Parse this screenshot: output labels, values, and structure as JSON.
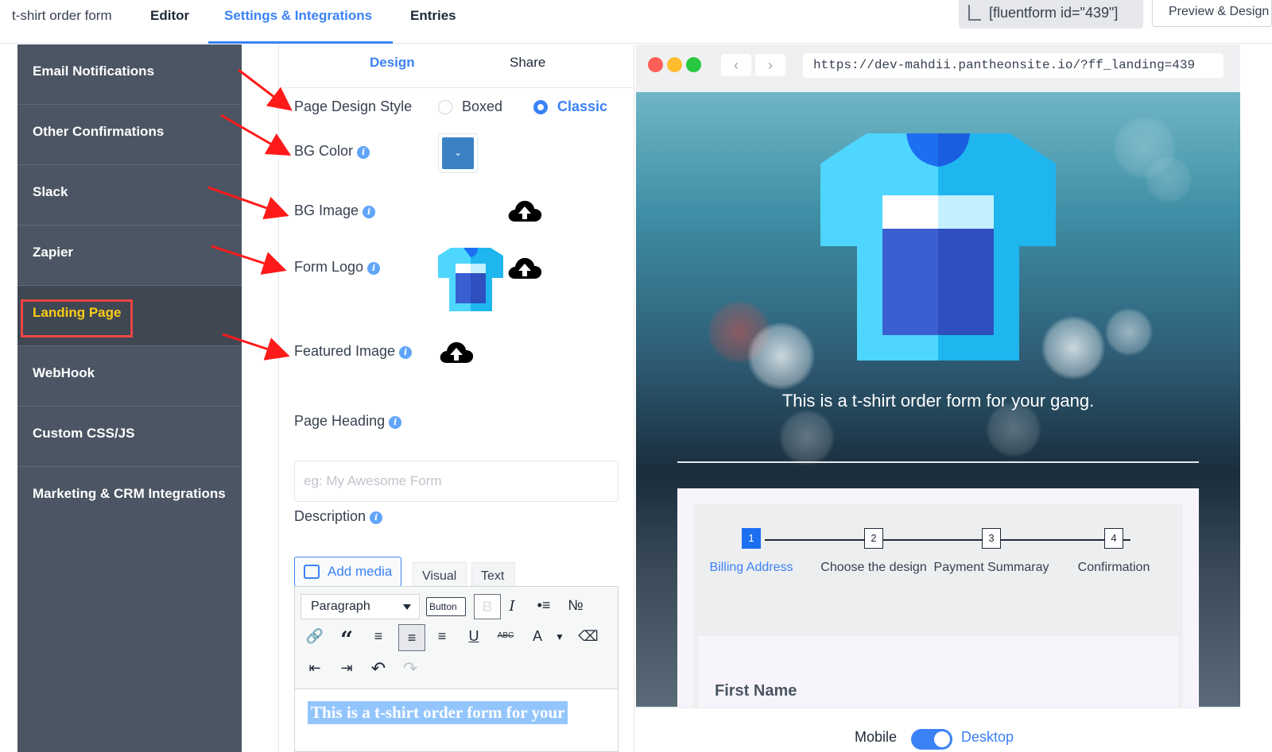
{
  "header": {
    "form_name": "t-shirt order form",
    "nav": [
      "Editor",
      "Settings & Integrations",
      "Entries"
    ],
    "active_nav": "Settings & Integrations",
    "shortcode": "[fluentform id=\"439\"]",
    "preview_label": "Preview & Design"
  },
  "sidebar": {
    "items": [
      {
        "label": "Email Notifications"
      },
      {
        "label": "Other Confirmations"
      },
      {
        "label": "Slack"
      },
      {
        "label": "Zapier"
      },
      {
        "label": "Landing Page"
      },
      {
        "label": "WebHook"
      },
      {
        "label": "Custom CSS/JS"
      },
      {
        "label": "Marketing & CRM Integrations"
      }
    ],
    "active": "Landing Page"
  },
  "settings": {
    "tabs": [
      "Design",
      "Share"
    ],
    "active_tab": "Design",
    "page_design_style": {
      "label": "Page Design Style",
      "options": [
        "Boxed",
        "Classic"
      ],
      "selected": "Classic"
    },
    "bg_color": {
      "label": "BG Color",
      "value": "#3b82c4"
    },
    "bg_image": {
      "label": "BG Image"
    },
    "form_logo": {
      "label": "Form Logo"
    },
    "featured_image": {
      "label": "Featured Image"
    },
    "page_heading": {
      "label": "Page Heading",
      "placeholder": "eg: My Awesome Form",
      "value": ""
    },
    "description": {
      "label": "Description",
      "add_media_label": "Add media",
      "editor_tabs": [
        "Visual",
        "Text"
      ],
      "format_select": "Paragraph",
      "button_label": "Button",
      "bold_glyph": "B",
      "content": "This is a t-shirt order form for your"
    }
  },
  "preview": {
    "url": "https://dev-mahdii.pantheonsite.io/?ff_landing=439",
    "back_glyph": "‹",
    "forward_glyph": "›",
    "tagline": "This is a t-shirt order form for your gang.",
    "steps": [
      {
        "number": "1",
        "label": "Billing Address"
      },
      {
        "number": "2",
        "label": "Choose the design"
      },
      {
        "number": "3",
        "label": "Payment Summaray"
      },
      {
        "number": "4",
        "label": "Confirmation"
      }
    ],
    "active_step": 1,
    "first_field_label": "First Name",
    "view_toggle": {
      "left": "Mobile",
      "right": "Desktop",
      "selected": "Desktop"
    }
  },
  "colors": {
    "accent": "#3b82f6",
    "sidebar_bg": "#4b5563",
    "sidebar_active_text": "#facc15",
    "highlight_red": "#ef4444",
    "tshirt_light": "#4fd6ff",
    "tshirt_dark": "#1fb6ef",
    "tshirt_pocket_light": "#3a5fd1",
    "tshirt_pocket_dark": "#2f4fbf"
  }
}
